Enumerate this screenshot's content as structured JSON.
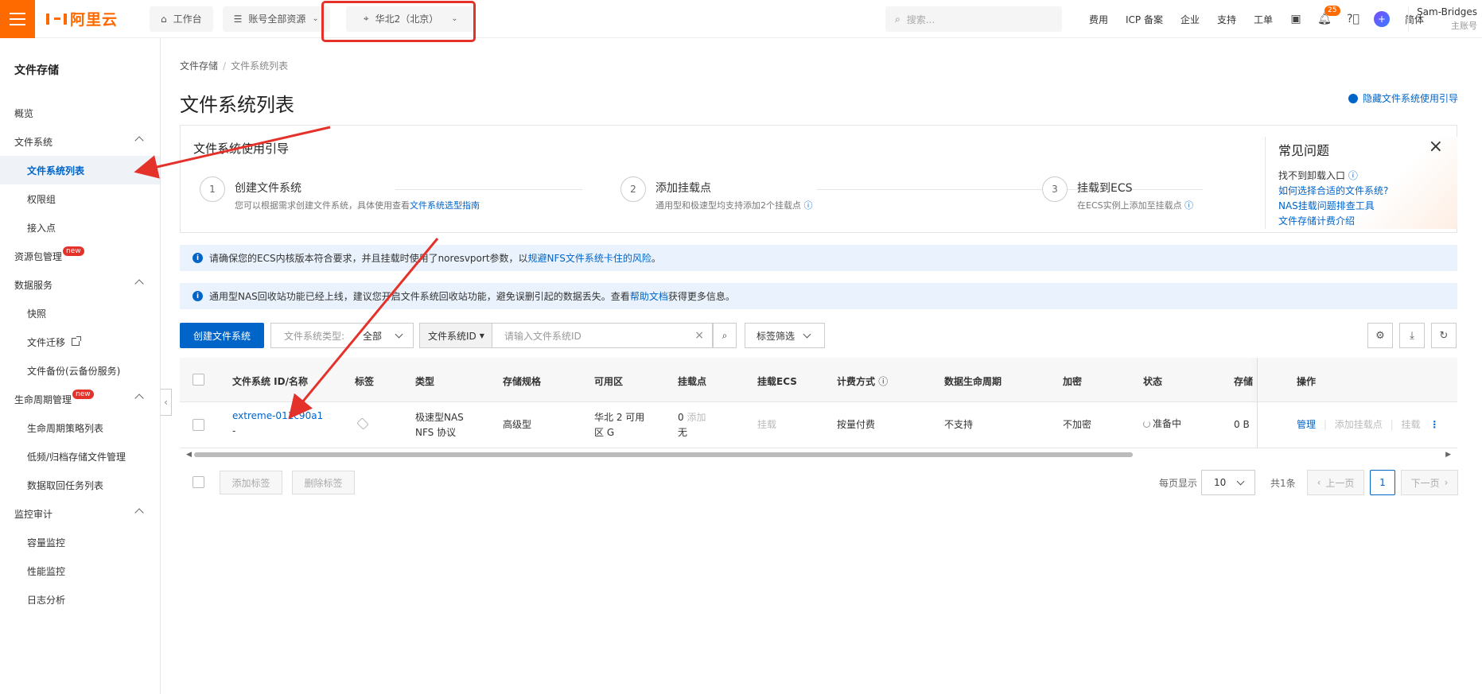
{
  "topbar": {
    "brand": "阿里云",
    "workbench": "工作台",
    "resources": "账号全部资源",
    "region": "华北2（北京）",
    "search_placeholder": "搜索...",
    "links": [
      "费用",
      "ICP 备案",
      "企业",
      "支持",
      "工单"
    ],
    "notification_count": "25",
    "language": "简体",
    "user_name": "Sam-Bridges",
    "user_role": "主账号"
  },
  "sidebar": {
    "title": "文件存储",
    "overview": "概览",
    "file_system": "文件系统",
    "fs_list": "文件系统列表",
    "permission_group": "权限组",
    "access_point": "接入点",
    "resource_pkg": "资源包管理",
    "new_label": "new",
    "data_service": "数据服务",
    "snapshot": "快照",
    "migration": "文件迁移",
    "backup": "文件备份(云备份服务)",
    "lifecycle": "生命周期管理",
    "lifecycle_policy": "生命周期策略列表",
    "archive": "低频/归档存储文件管理",
    "retrieve": "数据取回任务列表",
    "monitor": "监控审计",
    "capacity": "容量监控",
    "performance": "性能监控",
    "log": "日志分析"
  },
  "main": {
    "breadcrumb_root": "文件存储",
    "breadcrumb_current": "文件系统列表",
    "title": "文件系统列表",
    "hide_guide": "隐藏文件系统使用引导"
  },
  "guide": {
    "title": "文件系统使用引导",
    "steps": [
      {
        "num": "1",
        "title": "创建文件系统",
        "desc": "您可以根据需求创建文件系统，具体使用查看",
        "link": "文件系统选型指南"
      },
      {
        "num": "2",
        "title": "添加挂载点",
        "desc": "通用型和极速型均支持添加2个挂载点",
        "link": ""
      },
      {
        "num": "3",
        "title": "挂载到ECS",
        "desc": "在ECS实例上添加至挂载点",
        "link": ""
      }
    ],
    "faq_title": "常见问题",
    "faq": [
      "找不到卸载入口",
      "如何选择合适的文件系统?",
      "NAS挂载问题排查工具",
      "文件存储计费介绍"
    ]
  },
  "notices": {
    "n1_a": "请确保您的ECS内核版本符合要求，并且挂载时使用了noresvport参数，以",
    "n1_link": "规避NFS文件系统卡住的风险",
    "n1_b": "。",
    "n2_a": "通用型NAS回收站功能已经上线，建议您开启文件系统回收站功能，避免误删引起的数据丢失。查看",
    "n2_link": "帮助文档",
    "n2_b": "获得更多信息。"
  },
  "toolbar": {
    "create": "创建文件系统",
    "type_label": "文件系统类型:",
    "type_value": "全部",
    "id_select": "文件系统ID",
    "id_placeholder": "请输入文件系统ID",
    "tag_filter": "标签筛选"
  },
  "table": {
    "headers": [
      "文件系统 ID/名称",
      "标签",
      "类型",
      "存储规格",
      "可用区",
      "挂载点",
      "挂载ECS",
      "计费方式",
      "数据生命周期",
      "加密",
      "状态",
      "存储",
      "操作"
    ],
    "row": {
      "id": "extreme-011c90a1",
      "name": "-",
      "type_1": "极速型NAS",
      "type_2": "NFS 协议",
      "spec": "高级型",
      "zone_1": "华北 2 可用",
      "zone_2": "区 G",
      "mount_count": "0",
      "mount_add": "添加",
      "mount_none": "无",
      "mount_ecs": "挂载",
      "billing": "按量付费",
      "lifecycle": "不支持",
      "encrypt": "不加密",
      "status": "准备中",
      "storage": "0 B",
      "op_manage": "管理",
      "op_add_mount": "添加挂载点",
      "op_mount": "挂载"
    }
  },
  "footer": {
    "add_tag": "添加标签",
    "del_tag": "删除标签",
    "per_page_label": "每页显示",
    "per_page": "10",
    "total": "共1条",
    "prev": "上一页",
    "page": "1",
    "next": "下一页"
  },
  "colors": {
    "accent": "#ff6a00",
    "link": "#0064c8",
    "annotation": "#e4322b"
  }
}
